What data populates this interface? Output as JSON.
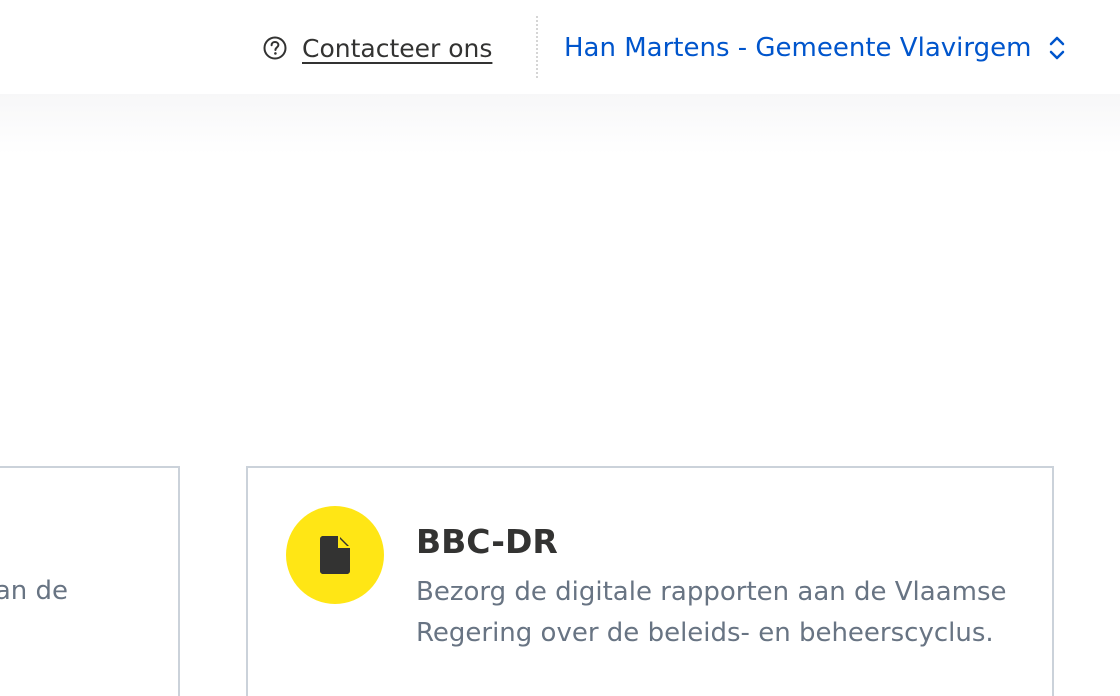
{
  "header": {
    "contact_label": "Contacteer ons",
    "user_label": "Han Martens - Gemeente Vlavirgem"
  },
  "cards": [
    {
      "title": "",
      "description": "an de"
    },
    {
      "title": "BBC-DR",
      "description": "Bezorg de digitale rapporten aan de Vlaamse Regering over de beleids- en beheerscyclus.",
      "icon": "document-icon",
      "icon_color": "#ffe615"
    }
  ],
  "colors": {
    "link_blue": "#0055cc",
    "text_dark": "#333332",
    "text_muted": "#687483",
    "card_border": "#cbd2da",
    "accent_yellow": "#ffe615"
  }
}
